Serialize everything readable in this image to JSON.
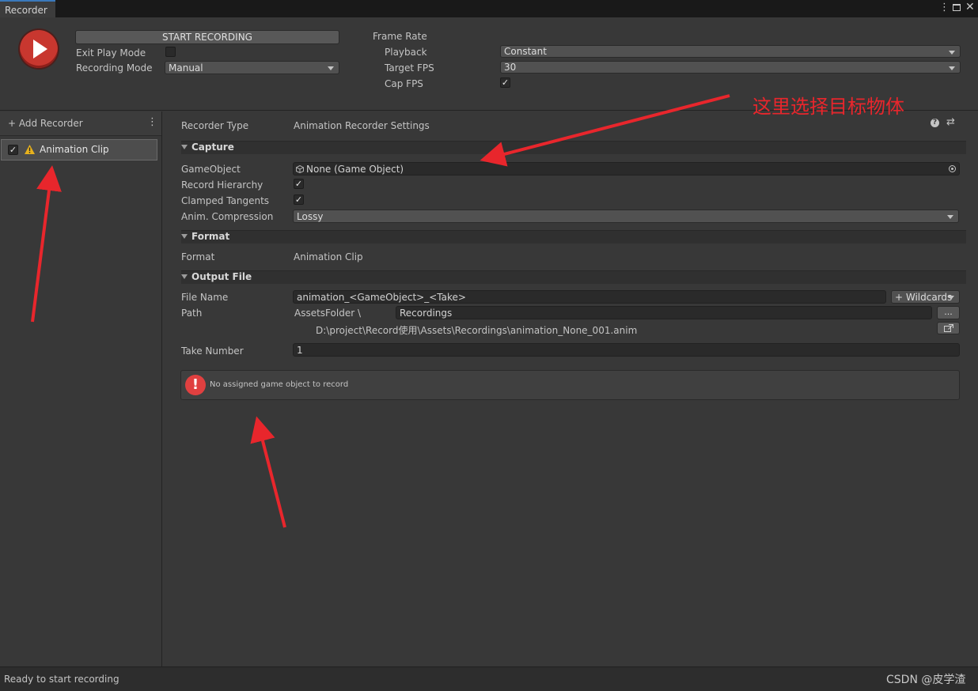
{
  "window": {
    "tab_title": "Recorder"
  },
  "top": {
    "start_button_label": "START RECORDING",
    "exit_play_mode_label": "Exit Play Mode",
    "exit_play_mode_checked": false,
    "recording_mode_label": "Recording Mode",
    "recording_mode_value": "Manual",
    "frame_rate_label": "Frame Rate",
    "playback_label": "Playback",
    "playback_value": "Constant",
    "target_fps_label": "Target FPS",
    "target_fps_value": "30",
    "cap_fps_label": "Cap FPS",
    "cap_fps_checked": true
  },
  "sidebar": {
    "add_recorder_label": "+ Add Recorder",
    "items": [
      {
        "label": "Animation Clip",
        "enabled": true,
        "warning": true
      }
    ]
  },
  "settings": {
    "recorder_type_label": "Recorder Type",
    "recorder_type_value": "Animation Recorder Settings",
    "capture": {
      "title": "Capture",
      "gameobject_label": "GameObject",
      "gameobject_value": "None (Game Object)",
      "record_hierarchy_label": "Record Hierarchy",
      "record_hierarchy_checked": true,
      "clamped_tangents_label": "Clamped Tangents",
      "clamped_tangents_checked": true,
      "anim_compression_label": "Anim. Compression",
      "anim_compression_value": "Lossy"
    },
    "format": {
      "title": "Format",
      "format_label": "Format",
      "format_value": "Animation Clip"
    },
    "output": {
      "title": "Output File",
      "file_name_label": "File Name",
      "file_name_value": "animation_<GameObject>_<Take>",
      "wildcards_label": "+ Wildcards",
      "path_label": "Path",
      "path_root": "AssetsFolder \\",
      "path_value": "Recordings",
      "browse_label": "...",
      "full_path": "D:\\project\\Record使用\\Assets\\Recordings\\animation_None_001.anim",
      "take_number_label": "Take Number",
      "take_number_value": "1"
    },
    "warning_text": "No assigned game object to record"
  },
  "annotation": {
    "text": "这里选择目标物体",
    "color": "#e8262c"
  },
  "status": {
    "text": "Ready to start recording",
    "watermark": "CSDN @皮学渣"
  },
  "colors": {
    "accent_red": "#c8372f",
    "tab_accent": "#3a79bb",
    "warning_yellow": "#e8b21d"
  }
}
